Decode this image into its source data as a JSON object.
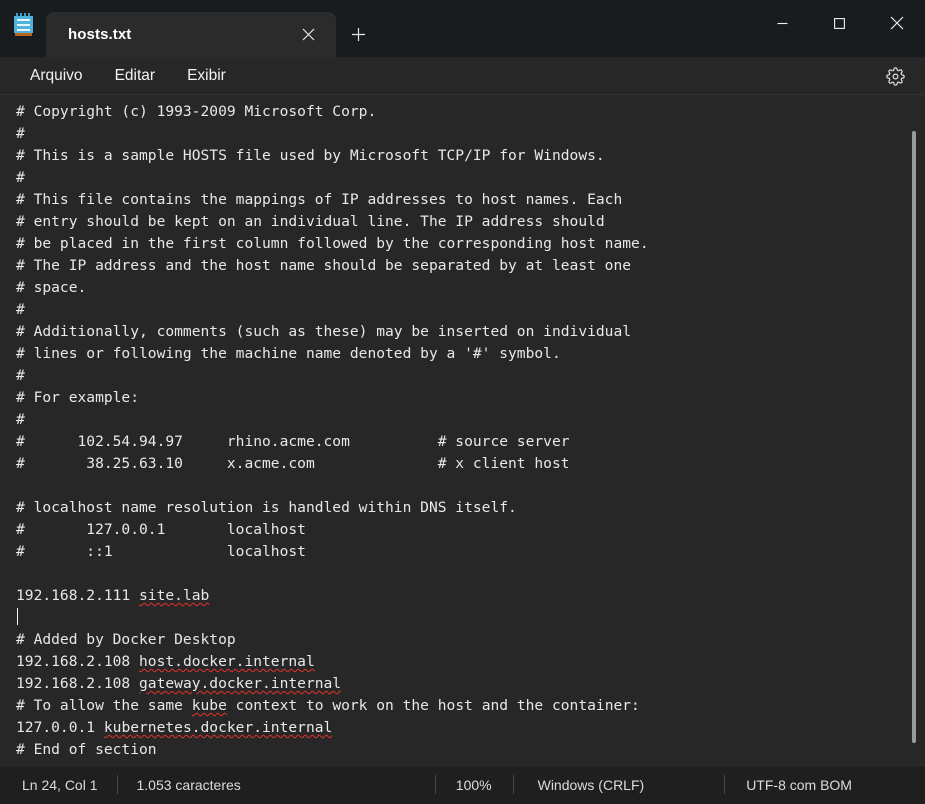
{
  "window": {
    "app_icon": "notepad-icon",
    "controls": {
      "minimize": "minimize-icon",
      "maximize": "maximize-icon",
      "close": "close-icon"
    }
  },
  "tabs": [
    {
      "title": "hosts.txt",
      "active": true,
      "close_icon": "close-icon"
    }
  ],
  "new_tab": {
    "label": "+",
    "icon": "plus-icon"
  },
  "menubar": {
    "items": [
      {
        "label": "Arquivo"
      },
      {
        "label": "Editar"
      },
      {
        "label": "Exibir"
      }
    ],
    "settings_icon": "gear-icon"
  },
  "editor": {
    "lines": [
      {
        "segments": [
          {
            "text": "# Copyright (c) 1993-2009 Microsoft Corp."
          }
        ]
      },
      {
        "segments": [
          {
            "text": "#"
          }
        ]
      },
      {
        "segments": [
          {
            "text": "# This is a sample HOSTS file used by Microsoft TCP/IP for Windows."
          }
        ]
      },
      {
        "segments": [
          {
            "text": "#"
          }
        ]
      },
      {
        "segments": [
          {
            "text": "# This file contains the mappings of IP addresses to host names. Each"
          }
        ]
      },
      {
        "segments": [
          {
            "text": "# entry should be kept on an individual line. The IP address should"
          }
        ]
      },
      {
        "segments": [
          {
            "text": "# be placed in the first column followed by the corresponding host name."
          }
        ]
      },
      {
        "segments": [
          {
            "text": "# The IP address and the host name should be separated by at least one"
          }
        ]
      },
      {
        "segments": [
          {
            "text": "# space."
          }
        ]
      },
      {
        "segments": [
          {
            "text": "#"
          }
        ]
      },
      {
        "segments": [
          {
            "text": "# Additionally, comments (such as these) may be inserted on individual"
          }
        ]
      },
      {
        "segments": [
          {
            "text": "# lines or following the machine name denoted by a '#' symbol."
          }
        ]
      },
      {
        "segments": [
          {
            "text": "#"
          }
        ]
      },
      {
        "segments": [
          {
            "text": "# For example:"
          }
        ]
      },
      {
        "segments": [
          {
            "text": "#"
          }
        ]
      },
      {
        "segments": [
          {
            "text": "#      102.54.94.97     rhino.acme.com          # source server"
          }
        ]
      },
      {
        "segments": [
          {
            "text": "#       38.25.63.10     x.acme.com              # x client host"
          }
        ]
      },
      {
        "segments": [
          {
            "text": ""
          }
        ]
      },
      {
        "segments": [
          {
            "text": "# localhost name resolution is handled within DNS itself."
          }
        ]
      },
      {
        "segments": [
          {
            "text": "#       127.0.0.1       localhost"
          }
        ]
      },
      {
        "segments": [
          {
            "text": "#       ::1             localhost"
          }
        ]
      },
      {
        "segments": [
          {
            "text": ""
          }
        ]
      },
      {
        "segments": [
          {
            "text": "192.168.2.111 "
          },
          {
            "text": "site.lab",
            "spell": true
          }
        ]
      },
      {
        "segments": [
          {
            "text": "",
            "caret": true
          }
        ]
      },
      {
        "segments": [
          {
            "text": "# Added by Docker Desktop"
          }
        ]
      },
      {
        "segments": [
          {
            "text": "192.168.2.108 "
          },
          {
            "text": "host.docker.internal",
            "spell": true
          }
        ]
      },
      {
        "segments": [
          {
            "text": "192.168.2.108 "
          },
          {
            "text": "gateway.docker.internal",
            "spell": true
          }
        ]
      },
      {
        "segments": [
          {
            "text": "# To allow the same "
          },
          {
            "text": "kube",
            "spell": true
          },
          {
            "text": " context to work on the host and the container:"
          }
        ]
      },
      {
        "segments": [
          {
            "text": "127.0.0.1 "
          },
          {
            "text": "kubernetes.docker.internal",
            "spell": true
          }
        ]
      },
      {
        "segments": [
          {
            "text": "# End of section"
          }
        ]
      }
    ],
    "scrollbar": {
      "visible": true
    }
  },
  "statusbar": {
    "cursor_position": "Ln 24, Col 1",
    "character_count": "1.053 caracteres",
    "zoom": "100%",
    "line_ending": "Windows (CRLF)",
    "encoding": "UTF-8 com BOM"
  },
  "colors": {
    "titlebar_bg": "#191c1f",
    "tab_bg": "#2b2b2b",
    "editor_bg": "#272727",
    "statusbar_bg": "#1f1f1f",
    "text": "#e8e8e8",
    "spellcheck_underline": "#e2322b",
    "icon_accent": "#4fb3d9"
  }
}
